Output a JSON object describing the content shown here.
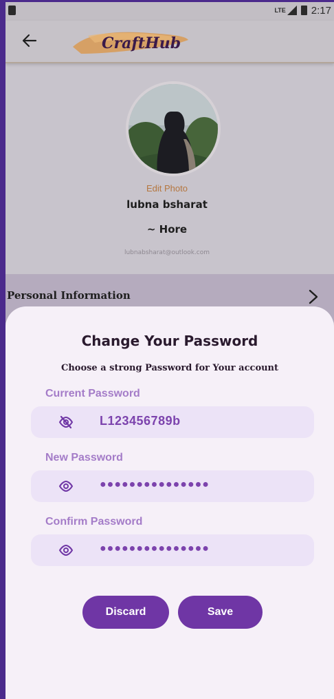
{
  "status_bar": {
    "network": "LTE",
    "time": "2:17"
  },
  "app_bar": {
    "logo_text": "CraftHub"
  },
  "profile": {
    "edit_photo_label": "Edit Photo",
    "name": "lubna bsharat",
    "bio": "~ Hore",
    "email": "lubnabsharat@outlook.com"
  },
  "personal_info": {
    "label": "Personal Information"
  },
  "change_password": {
    "title": "Change Your Password",
    "subtitle": "Choose a strong Password for Your account",
    "fields": [
      {
        "label": "Current Password",
        "value": "L123456789b",
        "icon": "eye-off-icon"
      },
      {
        "label": "New Password",
        "value": "●●●●●●●●●●●●●●●",
        "icon": "eye-icon"
      },
      {
        "label": "Confirm Password",
        "value": "●●●●●●●●●●●●●●●",
        "icon": "eye-icon"
      }
    ],
    "discard_label": "Discard",
    "save_label": "Save"
  },
  "colors": {
    "primary": "#6f36a5",
    "field_bg": "#ece3f7",
    "label": "#a47cc8",
    "edit_photo": "#b5763e",
    "sheet_bg": "#f6f0f8"
  }
}
